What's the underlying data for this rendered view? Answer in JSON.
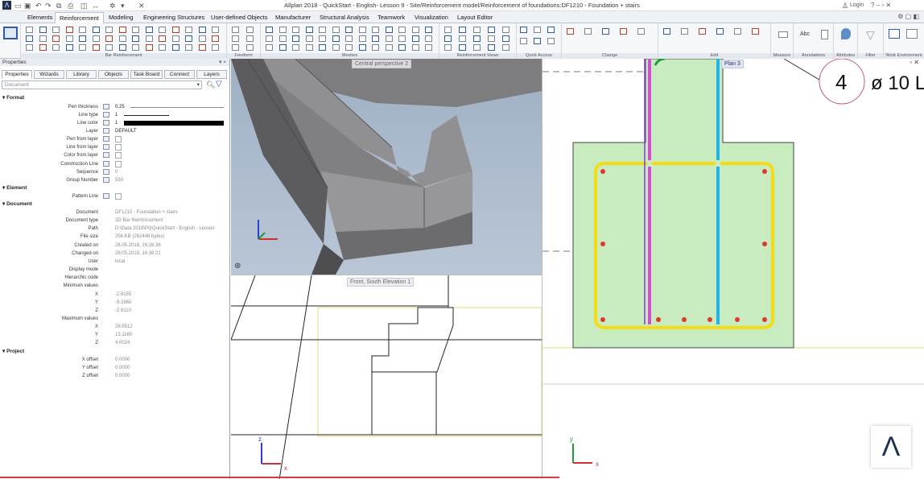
{
  "window": {
    "app_icon": "Λ",
    "title": "Allplan 2018 - QuickStart - English- Lesson 9 - Site/Reinforcement model/Reinforcement of foundations:DF1210 - Foundation + stairs",
    "login": "Login",
    "controls": "?  –  ▫  ✕"
  },
  "menu_tabs": [
    "Elements",
    "Reinforcement",
    "Modeling",
    "Engineering Structures",
    "User-defined Objects",
    "Manufacturer",
    "Structural Analysis",
    "Teamwork",
    "Visualization",
    "Layout Editor"
  ],
  "menu_active": "Reinforcement",
  "ribbon_groups": [
    "Bar Reinforcement",
    "Freeform",
    "Meshes",
    "Reinforcement Views",
    "Quick Access",
    "Change",
    "Edit",
    "Measure",
    "Annotations",
    "Attributes",
    "Filter",
    "Work Environment"
  ],
  "ribbon_annotation_label": "Abc",
  "panel": {
    "title": "Properties",
    "close": "▾ ×",
    "tabs": [
      "Properties",
      "Wizards",
      "Library",
      "Objects",
      "Task Board",
      "Connect",
      "Layers"
    ],
    "doc_selector": "Document",
    "sections": {
      "format": "Format",
      "element": "Element",
      "document": "Document",
      "project": "Project"
    },
    "format_rows": [
      {
        "label": "Pen thickness",
        "value": "0.25"
      },
      {
        "label": "Line type",
        "value": "1"
      },
      {
        "label": "Line color",
        "value": "1"
      },
      {
        "label": "Layer",
        "value": "DEFAULT"
      },
      {
        "label": "Pen from layer",
        "value": ""
      },
      {
        "label": "Line from layer",
        "value": ""
      },
      {
        "label": "Color from layer",
        "value": ""
      },
      {
        "label": "Construction Line",
        "value": ""
      },
      {
        "label": "Sequence",
        "value": "0"
      },
      {
        "label": "Group Number",
        "value": "550"
      }
    ],
    "element_rows": [
      {
        "label": "Pattern Line",
        "value": ""
      }
    ],
    "document_rows": [
      {
        "label": "Document",
        "value": "DF1210 - Foundation + stairs"
      },
      {
        "label": "Document type",
        "value": "3D Bar Reinforcement"
      },
      {
        "label": "Path",
        "value": "D:\\Data 2018\\Prj\\QuickStart - English - Lesson"
      },
      {
        "label": "File size",
        "value": "256 KB (262448 bytes)"
      },
      {
        "label": "Created on",
        "value": "28.05.2018, 16:26:38"
      },
      {
        "label": "Changed on",
        "value": "28.05.2018, 16:38:21"
      },
      {
        "label": "User",
        "value": "local"
      },
      {
        "label": "Display mode",
        "value": ""
      },
      {
        "label": "Hierarchic code",
        "value": ""
      },
      {
        "label": "Minimum values",
        "value": ""
      },
      {
        "label": "X",
        "value": "-2.6155"
      },
      {
        "label": "Y",
        "value": "-9.1660"
      },
      {
        "label": "Z",
        "value": "-2.9110"
      },
      {
        "label": "Maximum values",
        "value": ""
      },
      {
        "label": "X",
        "value": "26.5512"
      },
      {
        "label": "Y",
        "value": "13.1160"
      },
      {
        "label": "Z",
        "value": "4.0024"
      }
    ],
    "project_rows": [
      {
        "label": "X offset",
        "value": "0.0000"
      },
      {
        "label": "Y offset",
        "value": "0.0000"
      },
      {
        "label": "Z offset",
        "value": "0.0000"
      }
    ]
  },
  "viewports": {
    "perspective": "Central perspective 2",
    "front": "Front, South Elevation 1",
    "plan": "Plan 3"
  },
  "bar_label": {
    "number": "4",
    "text": "ø 10 L"
  },
  "axes": {
    "x": "x",
    "y": "y",
    "z": "z"
  },
  "watermark": "Λ",
  "colors": {
    "accent": "#2c5ca8",
    "concrete_fill": "#c8ecc0",
    "stirrup": "#f4dc14",
    "bar_magenta": "#d94bd6",
    "bar_cyan": "#22b4e8",
    "bar_dot": "#e03a2a"
  }
}
